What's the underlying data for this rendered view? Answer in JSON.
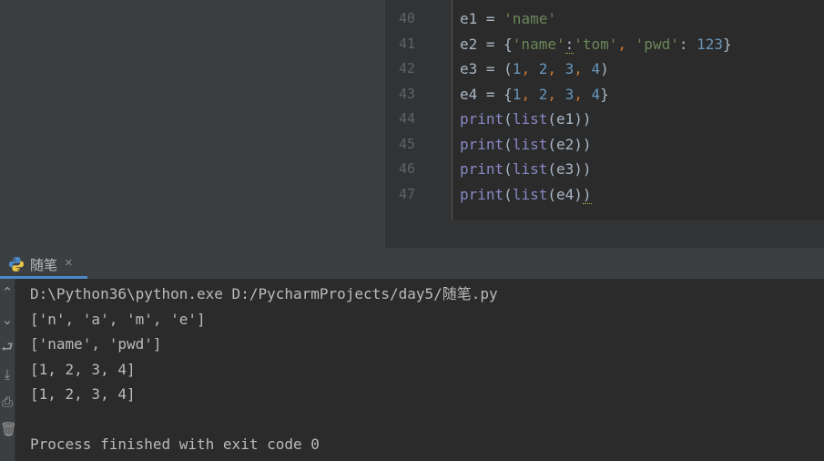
{
  "editor": {
    "lines": [
      {
        "number": "40",
        "tokens": [
          {
            "t": "e1 = ",
            "c": "plain"
          },
          {
            "t": "'name'",
            "c": "str"
          }
        ]
      },
      {
        "number": "41",
        "tokens": [
          {
            "t": "e2 = {",
            "c": "plain"
          },
          {
            "t": "'name'",
            "c": "str"
          },
          {
            "t": ":",
            "c": "dotted"
          },
          {
            "t": "'tom'",
            "c": "str"
          },
          {
            "t": ", ",
            "c": "kw"
          },
          {
            "t": "'pwd'",
            "c": "str"
          },
          {
            "t": ": ",
            "c": "plain"
          },
          {
            "t": "123",
            "c": "numlit"
          },
          {
            "t": "}",
            "c": "plain"
          }
        ]
      },
      {
        "number": "42",
        "tokens": [
          {
            "t": "e3 = (",
            "c": "plain"
          },
          {
            "t": "1",
            "c": "numlit"
          },
          {
            "t": ", ",
            "c": "kw"
          },
          {
            "t": "2",
            "c": "numlit"
          },
          {
            "t": ", ",
            "c": "kw"
          },
          {
            "t": "3",
            "c": "numlit"
          },
          {
            "t": ", ",
            "c": "kw"
          },
          {
            "t": "4",
            "c": "numlit"
          },
          {
            "t": ")",
            "c": "plain"
          }
        ]
      },
      {
        "number": "43",
        "tokens": [
          {
            "t": "e4 = {",
            "c": "plain"
          },
          {
            "t": "1",
            "c": "numlit"
          },
          {
            "t": ", ",
            "c": "kw"
          },
          {
            "t": "2",
            "c": "numlit"
          },
          {
            "t": ", ",
            "c": "kw"
          },
          {
            "t": "3",
            "c": "numlit"
          },
          {
            "t": ", ",
            "c": "kw"
          },
          {
            "t": "4",
            "c": "numlit"
          },
          {
            "t": "}",
            "c": "plain"
          }
        ]
      },
      {
        "number": "44",
        "tokens": [
          {
            "t": "print",
            "c": "fn"
          },
          {
            "t": "(",
            "c": "plain"
          },
          {
            "t": "list",
            "c": "fn"
          },
          {
            "t": "(e1))",
            "c": "plain"
          }
        ]
      },
      {
        "number": "45",
        "tokens": [
          {
            "t": "print",
            "c": "fn"
          },
          {
            "t": "(",
            "c": "plain"
          },
          {
            "t": "list",
            "c": "fn"
          },
          {
            "t": "(e2))",
            "c": "plain"
          }
        ]
      },
      {
        "number": "46",
        "tokens": [
          {
            "t": "print",
            "c": "fn"
          },
          {
            "t": "(",
            "c": "plain"
          },
          {
            "t": "list",
            "c": "fn"
          },
          {
            "t": "(e3))",
            "c": "plain"
          }
        ]
      },
      {
        "number": "47",
        "tokens": [
          {
            "t": "print",
            "c": "fn"
          },
          {
            "t": "(",
            "c": "plain"
          },
          {
            "t": "list",
            "c": "fn"
          },
          {
            "t": "(e4)",
            "c": "plain"
          },
          {
            "t": ")",
            "c": "dotted"
          }
        ]
      }
    ]
  },
  "run_tab": {
    "label": "随笔",
    "icon": "python-icon",
    "close": "×"
  },
  "console": {
    "tools": [
      {
        "name": "scroll-up-icon",
        "glyph": "⌃"
      },
      {
        "name": "scroll-down-icon",
        "glyph": "⌄"
      },
      {
        "name": "soft-wrap-icon",
        "glyph": "⮐"
      },
      {
        "name": "scroll-to-end-icon",
        "glyph": "⤓"
      },
      {
        "name": "print-icon",
        "glyph": "⎙"
      },
      {
        "name": "delete-icon",
        "glyph": "🗑"
      }
    ],
    "lines": [
      "D:\\Python36\\python.exe D:/PycharmProjects/day5/随笔.py",
      "['n', 'a', 'm', 'e']",
      "['name', 'pwd']",
      "[1, 2, 3, 4]",
      "[1, 2, 3, 4]",
      "",
      "Process finished with exit code 0"
    ]
  },
  "colors": {
    "string": "#6a8759",
    "number": "#6897bb",
    "keyword": "#cc7832",
    "builtin": "#8888c6",
    "text": "#a9b7c6",
    "accent": "#4a88c7"
  }
}
